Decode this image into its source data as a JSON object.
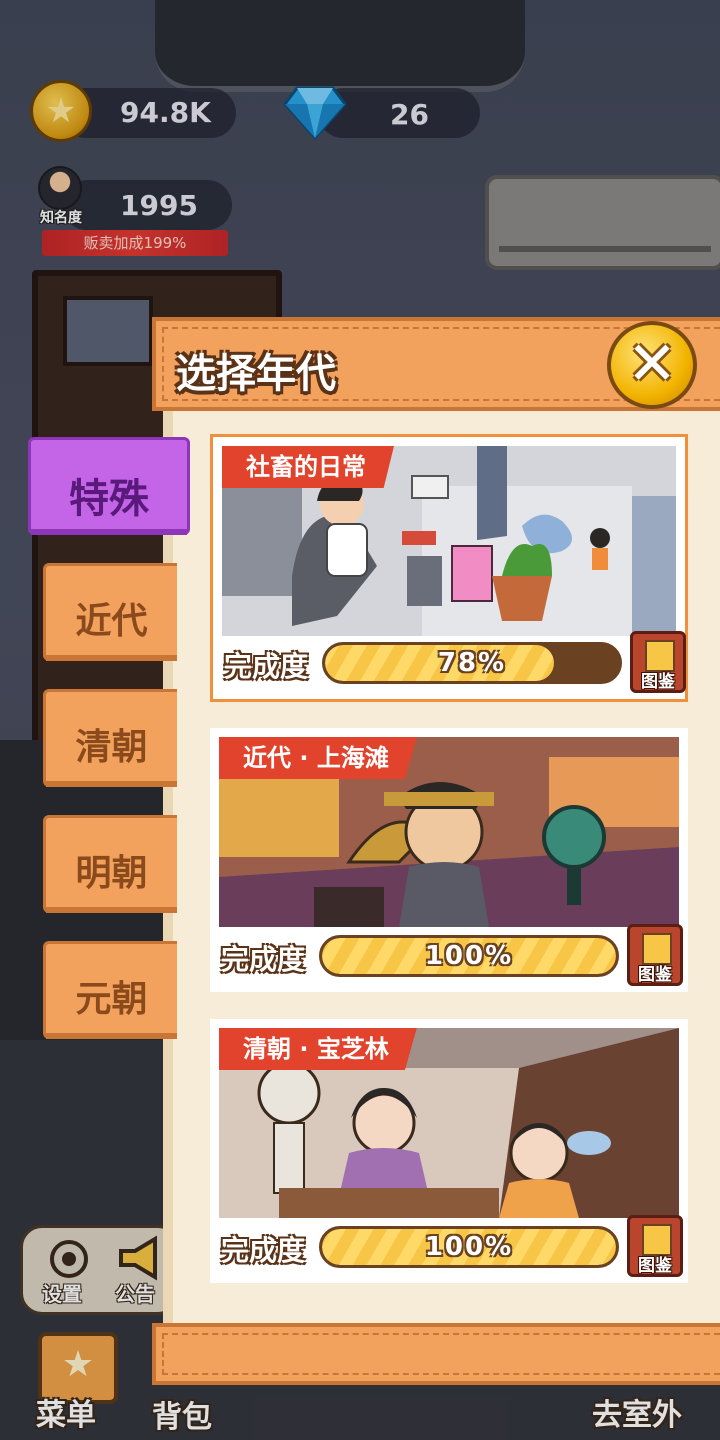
{
  "hud": {
    "coins": "94.8K",
    "gems": "26",
    "fame_label": "知名度",
    "fame_value": "1995",
    "bonus": "贩卖加成199%"
  },
  "modal": {
    "title": "选择年代",
    "close_icon": "close-icon"
  },
  "tabs": [
    {
      "label": "特殊",
      "active": true
    },
    {
      "label": "近代",
      "active": false
    },
    {
      "label": "清朝",
      "active": false
    },
    {
      "label": "明朝",
      "active": false
    },
    {
      "label": "元朝",
      "active": false
    }
  ],
  "eras": [
    {
      "name": "社畜的日常",
      "progress_label": "完成度",
      "progress_text": "78%",
      "progress": 0.78,
      "codex": "图鉴"
    },
    {
      "name": "近代 · 上海滩",
      "progress_label": "完成度",
      "progress_text": "100%",
      "progress": 1.0,
      "codex": "图鉴"
    },
    {
      "name": "清朝 · 宝芝林",
      "progress_label": "完成度",
      "progress_text": "100%",
      "progress": 1.0,
      "codex": "图鉴"
    }
  ],
  "bottom": {
    "settings": "设置",
    "notice": "公告",
    "menu": "菜单",
    "bag": "背包",
    "go_outside": "去室外"
  },
  "colors": {
    "tab": "#f2a25c",
    "tab_active": "#c465e8",
    "ribbon": "#e2432c",
    "progress_fill": "#f7c646"
  }
}
